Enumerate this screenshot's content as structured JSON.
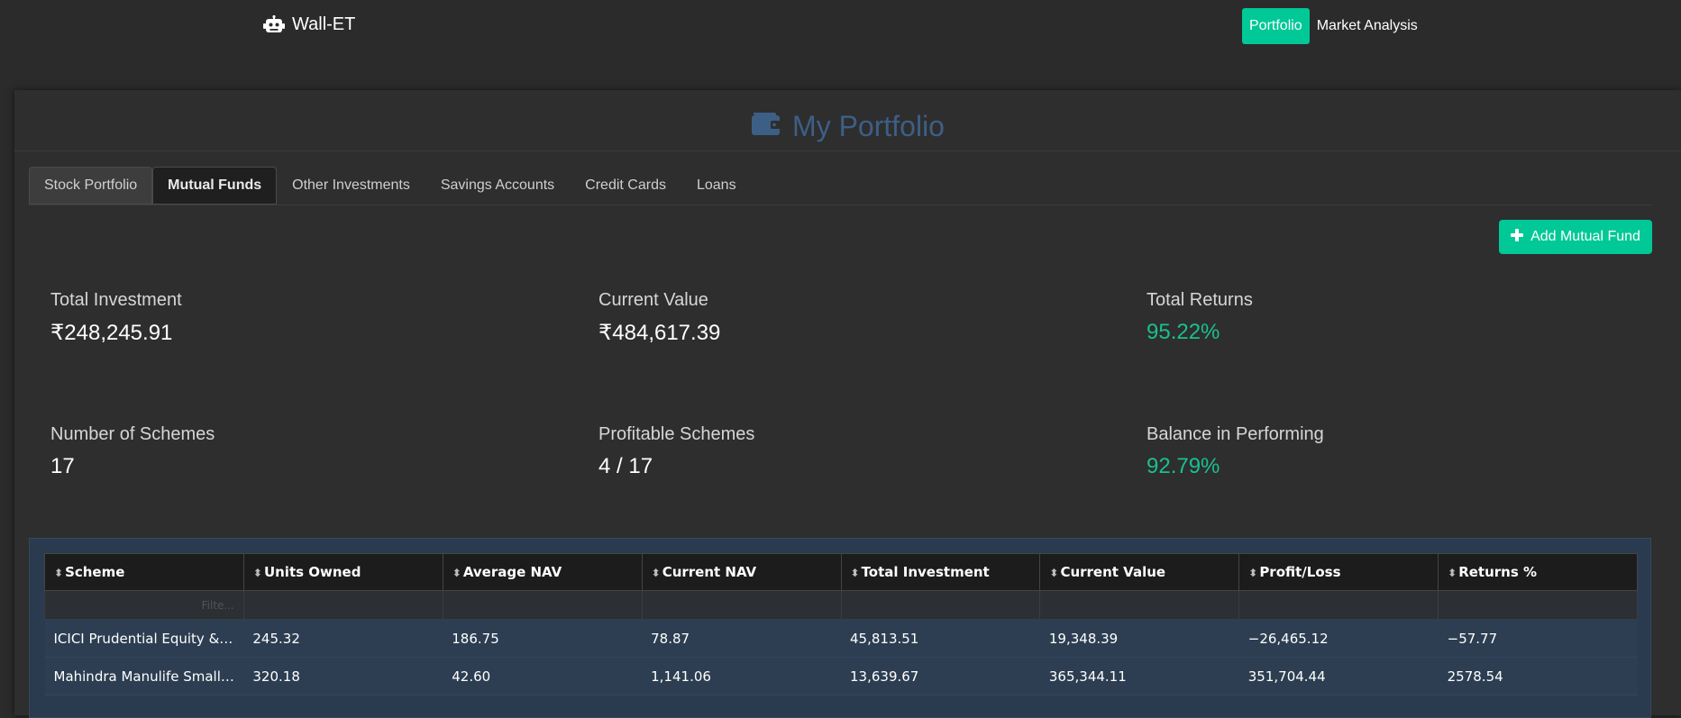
{
  "navbar": {
    "brand_icon": "robot-icon",
    "brand": "Wall-ET",
    "links": [
      {
        "label": "Portfolio",
        "active": true
      },
      {
        "label": "Market Analysis",
        "active": false
      }
    ]
  },
  "page": {
    "title_icon": "wallet-icon",
    "title": "My Portfolio"
  },
  "tabs": [
    {
      "label": "Stock Portfolio"
    },
    {
      "label": "Mutual Funds"
    },
    {
      "label": "Other Investments"
    },
    {
      "label": "Savings Accounts"
    },
    {
      "label": "Credit Cards"
    },
    {
      "label": "Loans"
    }
  ],
  "active_tab": "Mutual Funds",
  "add_button": {
    "icon": "plus-icon",
    "label": "Add Mutual Fund"
  },
  "stats": [
    {
      "label": "Total Investment",
      "value": "₹248,245.91"
    },
    {
      "label": "Current Value",
      "value": "₹484,617.39"
    },
    {
      "label": "Total Returns",
      "value": "95.22%"
    },
    {
      "label": "Number of Schemes",
      "value": "17"
    },
    {
      "label": "Profitable Schemes",
      "value": "4 / 17"
    },
    {
      "label": "Balance in Performing",
      "value": "92.79%"
    }
  ],
  "table": {
    "sort_icon": "sort-icon",
    "columns": [
      "Scheme",
      "Units Owned",
      "Average NAV",
      "Current NAV",
      "Total Investment",
      "Current Value",
      "Profit/Loss",
      "Returns %"
    ],
    "filter_placeholder": "Filte...",
    "rows": [
      [
        "ICICI Prudential Equity & ...",
        "245.32",
        "186.75",
        "78.87",
        "45,813.51",
        "19,348.39",
        "−26,465.12",
        "−57.77"
      ],
      [
        "Mahindra Manulife Small ...",
        "320.18",
        "42.60",
        "1,141.06",
        "13,639.67",
        "365,344.11",
        "351,704.44",
        "2578.54"
      ]
    ]
  },
  "colors": {
    "accent": "#00c896",
    "positive": "#19c08f",
    "title": "#3d5f86",
    "background": "#2b2b2b"
  }
}
